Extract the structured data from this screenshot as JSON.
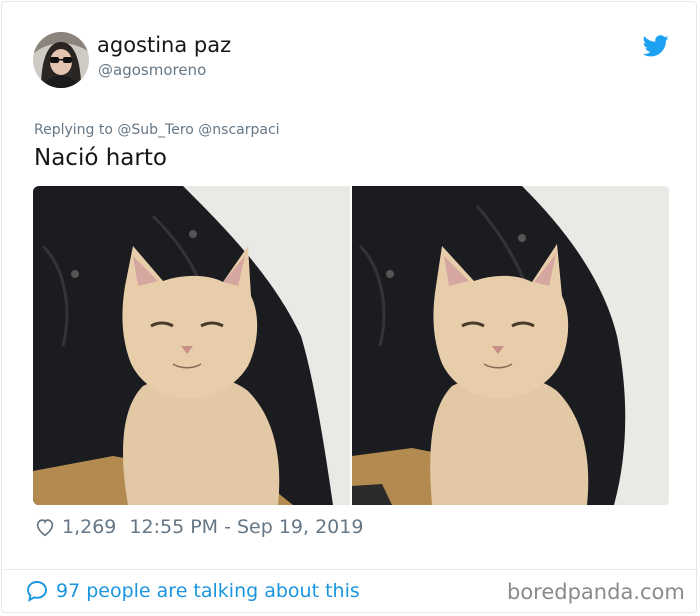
{
  "tweet": {
    "author_name": "agostina paz",
    "author_handle": "@agosmoreno",
    "reply_prefix": "Replying to",
    "reply_mentions": "@Sub_Tero @nscarpaci",
    "text": "Nació harto",
    "likes": "1,269",
    "timestamp": "12:55 PM - Sep 19, 2019",
    "talking": "97 people are talking about this"
  },
  "watermark": "boredpanda.com",
  "colors": {
    "twitter_blue": "#1da1f2",
    "link_blue": "#1b95e0",
    "muted_gray": "#657786",
    "text": "#14171a"
  },
  "icons": [
    "twitter-bird-icon",
    "heart-icon",
    "speech-bubble-icon"
  ]
}
